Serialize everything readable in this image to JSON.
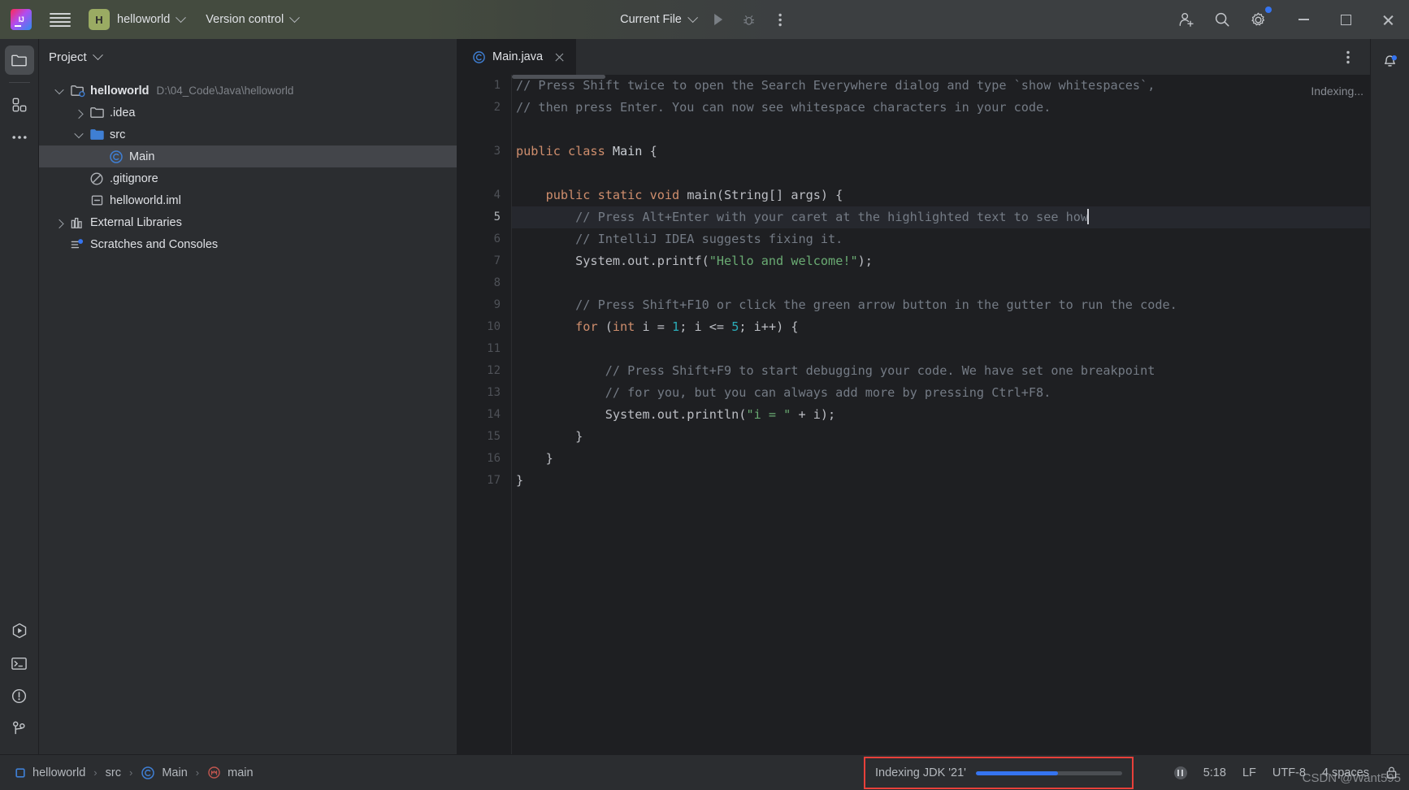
{
  "titlebar": {
    "logo_icon": "intellij-idea-logo",
    "menu_icon": "hamburger-menu-icon",
    "project_badge": "H",
    "project_name": "helloworld",
    "vcs_label": "Version control",
    "run_config": "Current File",
    "run_icon": "run-icon",
    "debug_icon": "debug-icon",
    "more_icon": "more-vertical-icon",
    "account_icon": "account-add-icon",
    "search_icon": "search-icon",
    "settings_icon": "gear-icon",
    "minimize_icon": "minimize-icon",
    "maximize_icon": "maximize-icon",
    "close_icon": "close-icon",
    "badge_color": "#3574f0"
  },
  "left_rail": {
    "top": [
      {
        "name": "project-tool-window",
        "icon": "folder-icon",
        "active": true
      },
      {
        "name": "structure-tool-window",
        "icon": "structure-icon",
        "active": false
      },
      {
        "name": "more-tool-windows",
        "icon": "more-horizontal-icon",
        "active": false
      }
    ],
    "bottom": [
      {
        "name": "run-tool-window",
        "icon": "run-hexagon-icon"
      },
      {
        "name": "terminal-tool-window",
        "icon": "terminal-icon"
      },
      {
        "name": "problems-tool-window",
        "icon": "warning-circle-icon"
      },
      {
        "name": "git-tool-window",
        "icon": "git-branch-icon"
      }
    ]
  },
  "project_panel": {
    "title": "Project",
    "title_chevron": "chevron-down-icon",
    "tree": [
      {
        "depth": 0,
        "twist": "down",
        "icon": "module-folder-icon",
        "label": "helloworld",
        "bold": true,
        "path": "D:\\04_Code\\Java\\helloworld",
        "selected": false
      },
      {
        "depth": 1,
        "twist": "right",
        "icon": "folder-icon",
        "label": ".idea",
        "bold": false,
        "path": "",
        "selected": false
      },
      {
        "depth": 1,
        "twist": "down",
        "icon": "source-folder-icon",
        "label": "src",
        "bold": false,
        "path": "",
        "selected": false
      },
      {
        "depth": 2,
        "twist": "none",
        "icon": "java-class-icon",
        "label": "Main",
        "bold": false,
        "path": "",
        "selected": true
      },
      {
        "depth": 1,
        "twist": "none",
        "icon": "gitignore-icon",
        "label": ".gitignore",
        "bold": false,
        "path": "",
        "selected": false
      },
      {
        "depth": 1,
        "twist": "none",
        "icon": "iml-file-icon",
        "label": "helloworld.iml",
        "bold": false,
        "path": "",
        "selected": false
      },
      {
        "depth": 0,
        "twist": "right",
        "icon": "libraries-icon",
        "label": "External Libraries",
        "bold": false,
        "path": "",
        "selected": false
      },
      {
        "depth": 0,
        "twist": "none",
        "icon": "scratches-icon",
        "label": "Scratches and Consoles",
        "bold": false,
        "path": "",
        "selected": false
      }
    ]
  },
  "editor": {
    "tabs": [
      {
        "label": "Main.java",
        "icon": "java-class-icon",
        "active": true,
        "close_icon": "close-icon"
      }
    ],
    "options_icon": "more-vertical-icon",
    "indexing_label": "Indexing...",
    "notification_icon": "bell-icon",
    "current_line": 5,
    "lines": [
      {
        "n": 1,
        "tokens": [
          {
            "t": "cmt",
            "v": "// Press Shift twice to open the Search Everywhere dialog and type `show whitespaces`,"
          }
        ]
      },
      {
        "n": 2,
        "tokens": [
          {
            "t": "cmt",
            "v": "// then press Enter. You can now see whitespace characters in your code."
          }
        ]
      },
      {
        "n": null,
        "tokens": []
      },
      {
        "n": 3,
        "tokens": [
          {
            "t": "kw",
            "v": "public class "
          },
          {
            "t": "cls",
            "v": "Main "
          },
          {
            "t": "brk",
            "v": "{"
          }
        ]
      },
      {
        "n": null,
        "tokens": []
      },
      {
        "n": 4,
        "tokens": [
          {
            "t": "txt",
            "v": "    "
          },
          {
            "t": "kw",
            "v": "public static void "
          },
          {
            "t": "txt",
            "v": "main(String[] args) {"
          }
        ]
      },
      {
        "n": 5,
        "tokens": [
          {
            "t": "cmt",
            "v": "        // Press Alt+Enter with your caret at the highlighted text to see how"
          }
        ]
      },
      {
        "n": 6,
        "tokens": [
          {
            "t": "cmt",
            "v": "        // IntelliJ IDEA suggests fixing it."
          }
        ]
      },
      {
        "n": 7,
        "tokens": [
          {
            "t": "txt",
            "v": "        System.out.printf("
          },
          {
            "t": "str",
            "v": "\"Hello and welcome!\""
          },
          {
            "t": "txt",
            "v": ");"
          }
        ]
      },
      {
        "n": 8,
        "tokens": []
      },
      {
        "n": 9,
        "tokens": [
          {
            "t": "cmt",
            "v": "        // Press Shift+F10 or click the green arrow button in the gutter to run the code."
          }
        ]
      },
      {
        "n": 10,
        "tokens": [
          {
            "t": "txt",
            "v": "        "
          },
          {
            "t": "kw",
            "v": "for "
          },
          {
            "t": "txt",
            "v": "("
          },
          {
            "t": "kw",
            "v": "int "
          },
          {
            "t": "txt",
            "v": "i = "
          },
          {
            "t": "num",
            "v": "1"
          },
          {
            "t": "txt",
            "v": "; i <= "
          },
          {
            "t": "num",
            "v": "5"
          },
          {
            "t": "txt",
            "v": "; i++) {"
          }
        ]
      },
      {
        "n": 11,
        "tokens": []
      },
      {
        "n": 12,
        "tokens": [
          {
            "t": "cmt",
            "v": "            // Press Shift+F9 to start debugging your code. We have set one breakpoint"
          }
        ]
      },
      {
        "n": 13,
        "tokens": [
          {
            "t": "cmt",
            "v": "            // for you, but you can always add more by pressing Ctrl+F8."
          }
        ]
      },
      {
        "n": 14,
        "tokens": [
          {
            "t": "txt",
            "v": "            System.out.println("
          },
          {
            "t": "str",
            "v": "\"i = \""
          },
          {
            "t": "txt",
            "v": " + i);"
          }
        ]
      },
      {
        "n": 15,
        "tokens": [
          {
            "t": "txt",
            "v": "        }"
          }
        ]
      },
      {
        "n": 16,
        "tokens": [
          {
            "t": "txt",
            "v": "    }"
          }
        ]
      },
      {
        "n": 17,
        "tokens": [
          {
            "t": "txt",
            "v": "}"
          }
        ]
      }
    ]
  },
  "breadcrumb": {
    "items": [
      {
        "label": "helloworld",
        "icon": "module-icon"
      },
      {
        "label": "src",
        "icon": "none"
      },
      {
        "label": "Main",
        "icon": "java-class-icon"
      },
      {
        "label": "main",
        "icon": "method-icon"
      }
    ],
    "separator": "›"
  },
  "statusbar": {
    "indexing_text": "Indexing JDK '21'",
    "progress_percent": 56,
    "highlight_color": "#e8403a",
    "progress_color": "#3574f0",
    "pause_icon": "pause-icon",
    "caret_position": "5:18",
    "line_separator": "LF",
    "encoding": "UTF-8",
    "indent": "4 spaces",
    "lock_icon": "lock-icon",
    "watermark": "CSDN @Want595"
  }
}
